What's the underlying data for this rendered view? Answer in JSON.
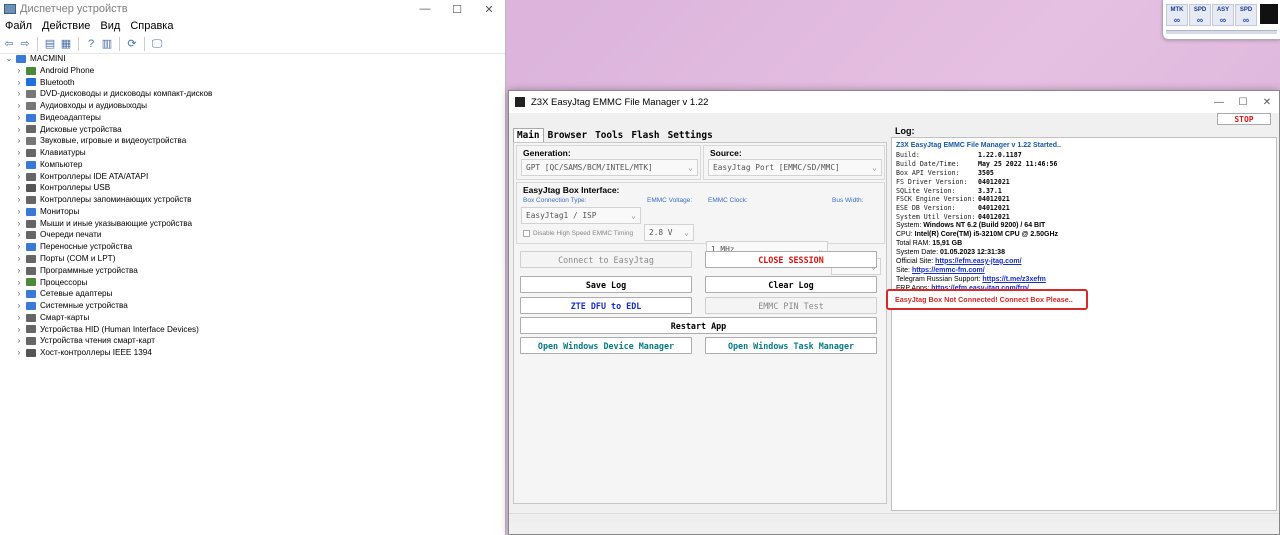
{
  "device_manager": {
    "title": "Диспетчер устройств",
    "menu": [
      "Файл",
      "Действие",
      "Вид",
      "Справка"
    ],
    "root": "MACMINI",
    "items": [
      {
        "label": "Android Phone",
        "color": "#4a8a3a"
      },
      {
        "label": "Bluetooth",
        "color": "#1e6fd9"
      },
      {
        "label": "DVD-дисководы и дисководы компакт-дисков",
        "color": "#777"
      },
      {
        "label": "Аудиовходы и аудиовыходы",
        "color": "#777"
      },
      {
        "label": "Видеоадаптеры",
        "color": "#3a7ad6"
      },
      {
        "label": "Дисковые устройства",
        "color": "#666"
      },
      {
        "label": "Звуковые, игровые и видеоустройства",
        "color": "#777"
      },
      {
        "label": "Клавиатуры",
        "color": "#666"
      },
      {
        "label": "Компьютер",
        "color": "#3a7ad6"
      },
      {
        "label": "Контроллеры IDE ATA/ATAPI",
        "color": "#666"
      },
      {
        "label": "Контроллеры USB",
        "color": "#555"
      },
      {
        "label": "Контроллеры запоминающих устройств",
        "color": "#666"
      },
      {
        "label": "Мониторы",
        "color": "#3a7ad6"
      },
      {
        "label": "Мыши и иные указывающие устройства",
        "color": "#666"
      },
      {
        "label": "Очереди печати",
        "color": "#666"
      },
      {
        "label": "Переносные устройства",
        "color": "#3a7ad6"
      },
      {
        "label": "Порты (COM и LPT)",
        "color": "#666"
      },
      {
        "label": "Программные устройства",
        "color": "#666"
      },
      {
        "label": "Процессоры",
        "color": "#4a8a3a"
      },
      {
        "label": "Сетевые адаптеры",
        "color": "#3a7ad6"
      },
      {
        "label": "Системные устройства",
        "color": "#3a7ad6"
      },
      {
        "label": "Смарт-карты",
        "color": "#666"
      },
      {
        "label": "Устройства HID (Human Interface Devices)",
        "color": "#666"
      },
      {
        "label": "Устройства чтения смарт-карт",
        "color": "#666"
      },
      {
        "label": "Хост-контроллеры IEEE 1394",
        "color": "#555"
      }
    ]
  },
  "widget": {
    "tiles": [
      "MTK",
      "SPD",
      "ASY",
      "SPD"
    ]
  },
  "z3x": {
    "title": "Z3X EasyJtag EMMC File Manager v 1.22",
    "tabs": [
      "Main",
      "Browser",
      "Tools",
      "Flash",
      "Settings"
    ],
    "stop": "STOP",
    "generation_label": "Generation:",
    "generation_value": "GPT [QC/SAMS/BCM/INTEL/MTK]",
    "source_label": "Source:",
    "source_value": "EasyJtag Port [EMMC/SD/MMC]",
    "box_iface_label": "EasyJtag Box Interface:",
    "conn_type_label": "Box Connection Type:",
    "conn_type_value": "EasyJtag1 / ISP",
    "voltage_label": "EMMC Voltage:",
    "voltage_value": "2.8 V",
    "clock_label": "EMMC Clock:",
    "clock_value": "1 MHz",
    "bus_label": "Bus Width:",
    "bus_value": "",
    "disable_hs": "Disable High Speed EMMC Timing",
    "btn_connect": "Connect to EasyJtag",
    "btn_close": "CLOSE SESSION",
    "btn_savelog": "Save Log",
    "btn_clearlog": "Clear Log",
    "btn_zte": "ZTE DFU to EDL",
    "btn_pin": "EMMC PIN Test",
    "btn_restart": "Restart App",
    "btn_devmgr": "Open Windows Device Manager",
    "btn_taskmgr": "Open Windows Task Manager",
    "log_label": "Log:",
    "log_title": "Z3X EasyJtag EMMC File Manager v 1.22 Started..",
    "log_kv": [
      {
        "k": "Build:",
        "v": "1.22.0.1187"
      },
      {
        "k": "Build Date/Time:",
        "v": "May 25 2022 11:46:56"
      },
      {
        "k": "Box API Version:",
        "v": "3505"
      },
      {
        "k": "FS Driver Version:",
        "v": "04012021"
      },
      {
        "k": "SQLite Version:",
        "v": "3.37.1"
      },
      {
        "k": "FSCK Engine Version:",
        "v": "04012021"
      },
      {
        "k": "ESE DB Version:",
        "v": "04012021"
      },
      {
        "k": "System Util Version:",
        "v": "04012021"
      }
    ],
    "log_sys": [
      {
        "k": "System: ",
        "v": "Windows NT 6.2 (Build 9200) / 64 BIT"
      },
      {
        "k": "CPU: ",
        "v": "Intel(R) Core(TM) i5-3210M CPU @ 2.50GHz"
      },
      {
        "k": "Total RAM: ",
        "v": "15,91 GB"
      },
      {
        "k": "System Date: ",
        "v": "01.05.2023 12:31:38"
      }
    ],
    "log_links": [
      {
        "k": "Official Site: ",
        "v": "https://efm.easy-jtag.com/"
      },
      {
        "k": "Site: ",
        "v": "https://emmc-fm.com/"
      },
      {
        "k": "Telegram Russian Support: ",
        "v": "https://t.me/z3xefm"
      },
      {
        "k": "FRP Apps: ",
        "v": "https://efm.easy-jtag.com/frp/"
      }
    ],
    "log_error": "EasyJtag Box Not Connected! Connect Box Please.."
  }
}
